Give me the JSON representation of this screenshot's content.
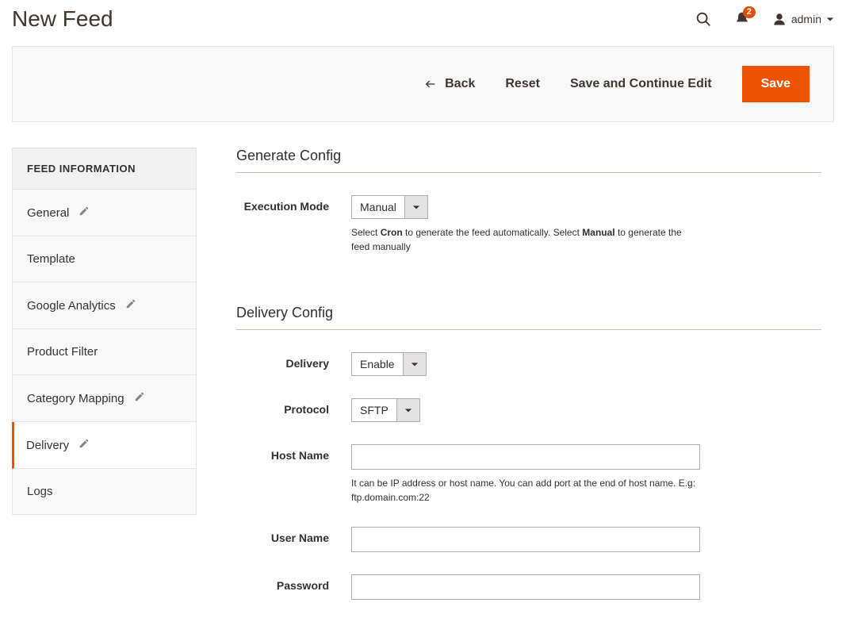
{
  "header": {
    "title": "New Feed",
    "notif_count": "2",
    "admin_label": "admin"
  },
  "actions": {
    "back": "Back",
    "reset": "Reset",
    "save_continue": "Save and Continue Edit",
    "save": "Save"
  },
  "sidebar": {
    "title": "FEED INFORMATION",
    "items": [
      {
        "label": "General",
        "pencil": true,
        "active": false
      },
      {
        "label": "Template",
        "pencil": false,
        "active": false
      },
      {
        "label": "Google Analytics",
        "pencil": true,
        "active": false
      },
      {
        "label": "Product Filter",
        "pencil": false,
        "active": false
      },
      {
        "label": "Category Mapping",
        "pencil": true,
        "active": false
      },
      {
        "label": "Delivery",
        "pencil": true,
        "active": true
      },
      {
        "label": "Logs",
        "pencil": false,
        "active": false
      }
    ]
  },
  "sections": {
    "generate": {
      "title": "Generate Config",
      "execution_mode": {
        "label": "Execution Mode",
        "value": "Manual",
        "note_pre": "Select ",
        "note_bold1": "Cron",
        "note_mid": " to generate the feed automatically. Select ",
        "note_bold2": "Manual",
        "note_post": " to generate the feed manually"
      }
    },
    "delivery": {
      "title": "Delivery Config",
      "delivery": {
        "label": "Delivery",
        "value": "Enable"
      },
      "protocol": {
        "label": "Protocol",
        "value": "SFTP"
      },
      "hostname": {
        "label": "Host Name",
        "value": "",
        "note": "It can be IP address or host name. You can add port at the end of host name. E.g: ftp.domain.com:22"
      },
      "username": {
        "label": "User Name",
        "value": ""
      },
      "password": {
        "label": "Password",
        "value": ""
      }
    }
  }
}
